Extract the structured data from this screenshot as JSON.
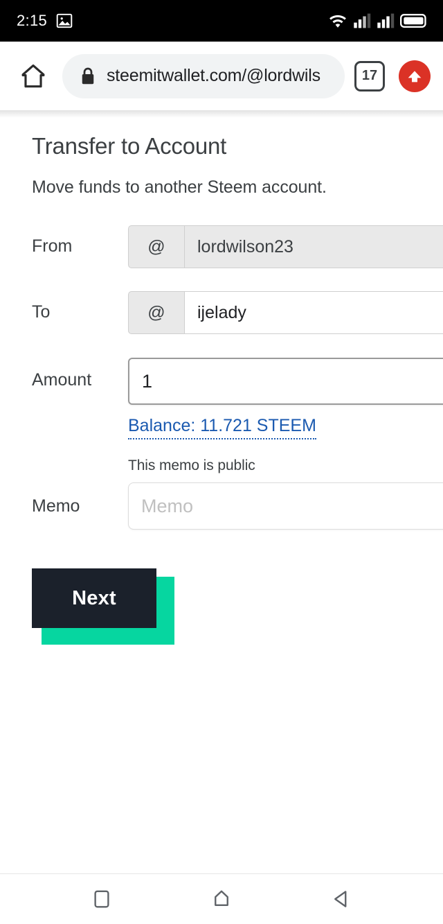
{
  "status_bar": {
    "clock": "2:15",
    "icons": [
      "photo-icon",
      "wifi-icon",
      "signal-icon-1",
      "signal-icon-2",
      "battery-icon"
    ]
  },
  "browser": {
    "home_icon": "home-icon",
    "lock_icon": "lock-icon",
    "url": "steemitwallet.com/@lordwils",
    "tab_count": "17",
    "menu_icon": "up-arrow-icon",
    "menu_color": "#db3226"
  },
  "page": {
    "title": "Transfer to Account",
    "subtitle": "Move funds to another Steem account."
  },
  "form": {
    "from": {
      "label": "From",
      "addon": "@",
      "value": "lordwilson23",
      "placeholder": ""
    },
    "to": {
      "label": "To",
      "addon": "@",
      "value": "ijelady",
      "placeholder": ""
    },
    "amount": {
      "label": "Amount",
      "value": "1",
      "placeholder": "",
      "balance_link": "Balance: 11.721 STEEM",
      "balance_color": "#1b5ab0"
    },
    "memo": {
      "label": "Memo",
      "hint": "This memo is public",
      "value": "",
      "placeholder": "Memo"
    },
    "submit": {
      "label": "Next",
      "bg_color": "#1b212b",
      "shadow_color": "#06d6a0"
    }
  },
  "nav_bar": {
    "recents": "square-icon",
    "home": "home-pentagon-icon",
    "back": "back-triangle-icon"
  }
}
